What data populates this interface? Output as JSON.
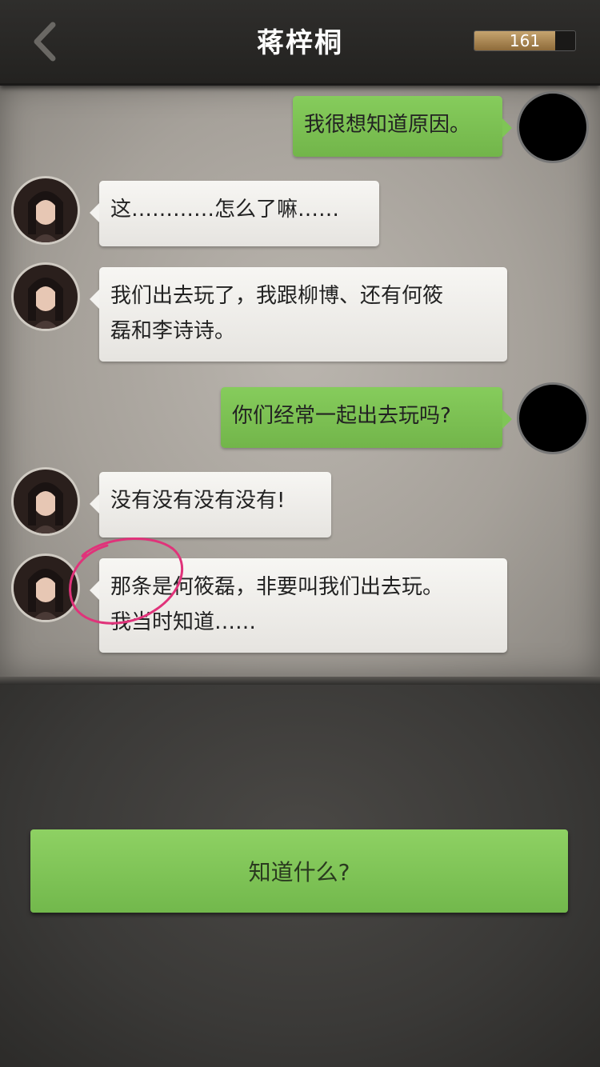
{
  "header": {
    "title": "蒋梓桐",
    "progress_value": "161",
    "progress_fraction": 0.8
  },
  "messages": [
    {
      "side": "right",
      "text": "我很想知道原因。"
    },
    {
      "side": "left",
      "text": "这…………怎么了嘛……"
    },
    {
      "side": "left",
      "lines": [
        "我们出去玩了，我跟柳博、还有何筱",
        "磊和李诗诗。"
      ]
    },
    {
      "side": "right",
      "text": "你们经常一起出去玩吗?"
    },
    {
      "side": "left",
      "text": "没有没有没有没有!"
    },
    {
      "side": "left",
      "lines": [
        "那条是何筱磊，非要叫我们出去玩。",
        "我当时知道……"
      ]
    }
  ],
  "choice": {
    "label": "知道什么?"
  },
  "colors": {
    "bubble_green": "#7fc556",
    "bubble_white": "#f3f2ef",
    "topbar": "#2a2927",
    "annotation": "#e0337a"
  },
  "icons": {
    "back": "chevron-left-icon"
  }
}
